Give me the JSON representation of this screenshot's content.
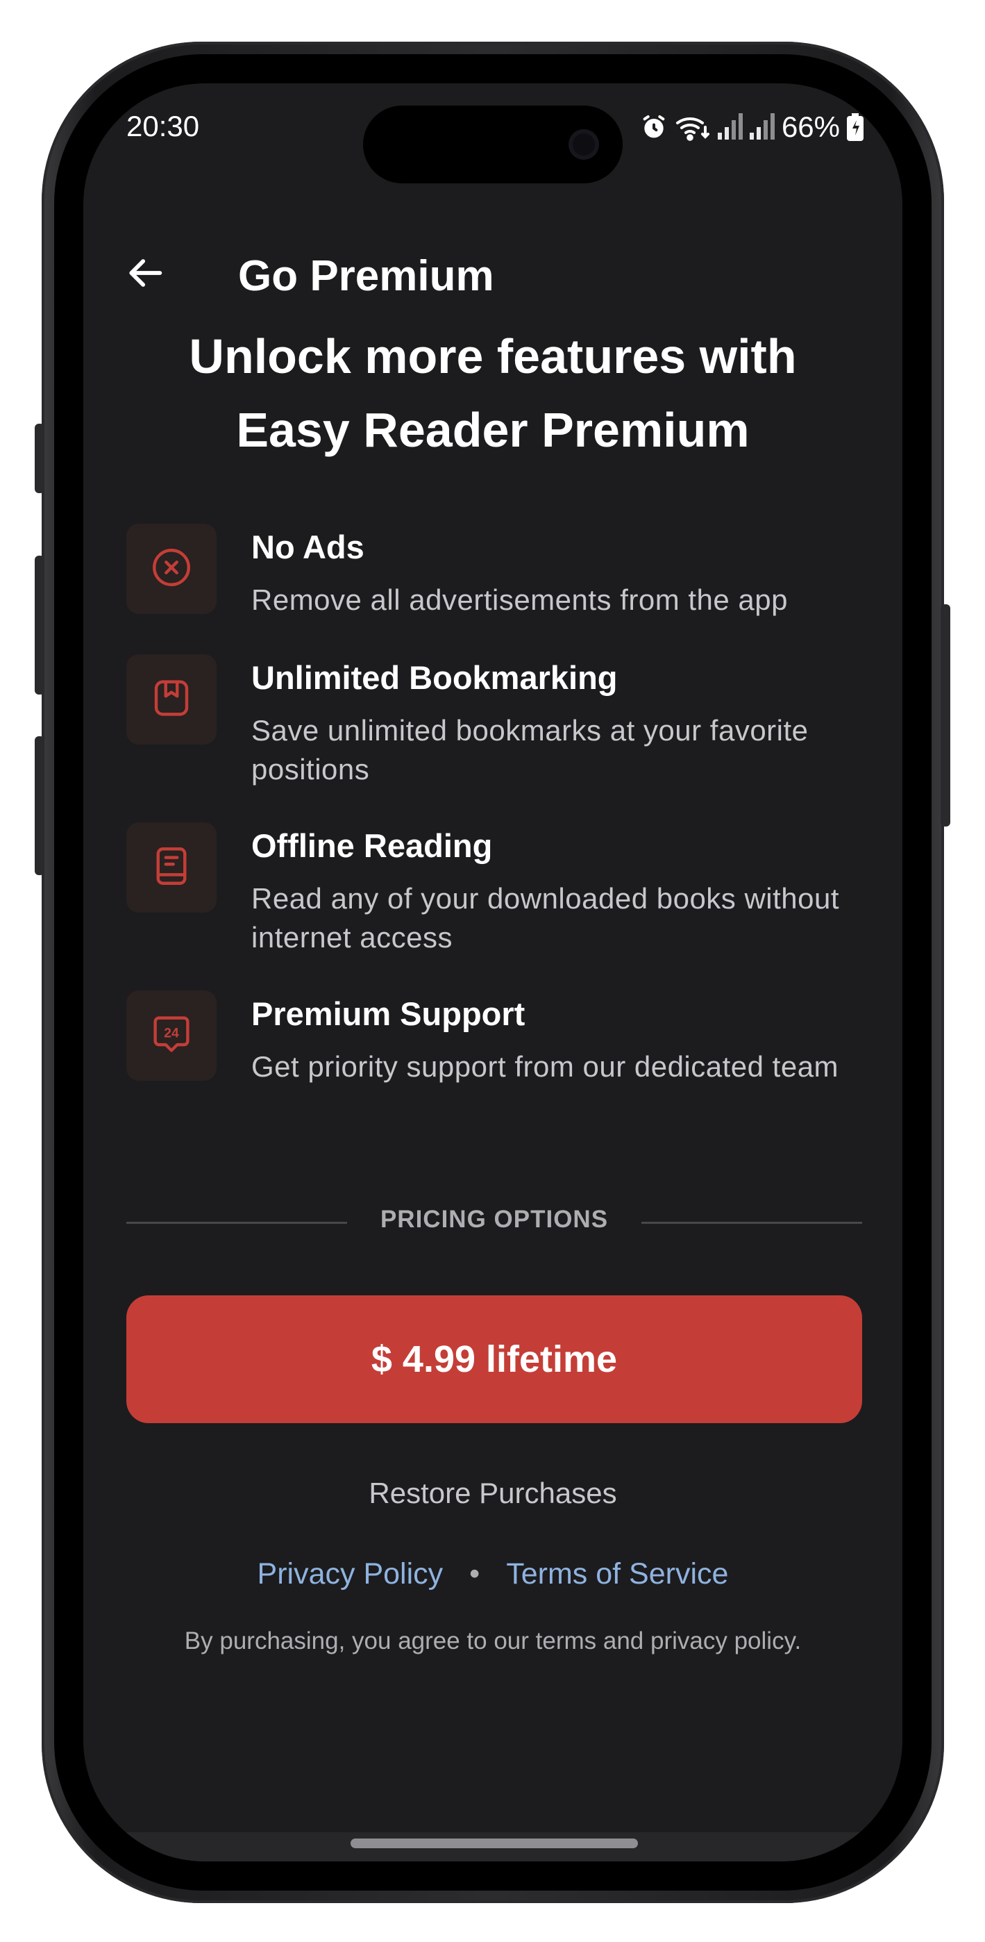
{
  "status_bar": {
    "time": "20:30",
    "battery": "66%",
    "icons": [
      "alarm-icon",
      "wifi-icon",
      "signal-icon",
      "signal-icon",
      "battery-icon"
    ]
  },
  "app_bar": {
    "title": "Go Premium",
    "back_icon": "arrow-left-icon"
  },
  "headline": {
    "line1": "Unlock more features with",
    "line2": "Easy Reader Premium"
  },
  "features": [
    {
      "icon": "close-circle-icon",
      "title": "No Ads",
      "description": "Remove all advertisements from the app"
    },
    {
      "icon": "bookmark-icon",
      "title": "Unlimited Bookmarking",
      "description": "Save unlimited bookmarks at your favorite positions"
    },
    {
      "icon": "book-icon",
      "title": "Offline Reading",
      "description": "Read any of your downloaded books without internet access"
    },
    {
      "icon": "support-24-icon",
      "title": "Premium Support",
      "description": "Get priority support from our dedicated team"
    }
  ],
  "pricing": {
    "section_label": "PRICING OPTIONS",
    "button_label": "$ 4.99 lifetime"
  },
  "footer": {
    "restore": "Restore Purchases",
    "privacy": "Privacy Policy",
    "separator": "•",
    "terms": "Terms of Service",
    "fine_print": "By purchasing, you agree to our terms and privacy policy."
  },
  "colors": {
    "background": "#1c1c1e",
    "accent": "#c43e37",
    "link": "#8fb3e0",
    "icon_tile": "#2a2121"
  }
}
